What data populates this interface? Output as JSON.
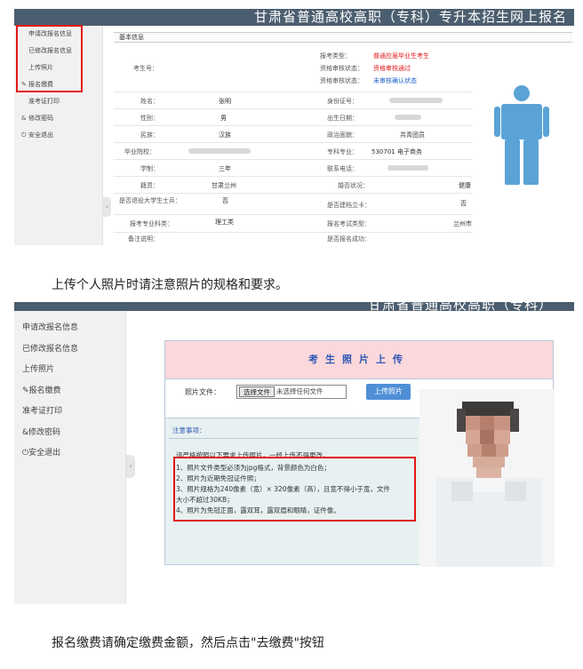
{
  "panel1": {
    "header_title": "甘肃省普通高校高职（专科）专升本招生网上报名",
    "sidebar": [
      {
        "glyph": "",
        "label": "申请改报名信息"
      },
      {
        "glyph": "",
        "label": "已修改报名信息"
      },
      {
        "glyph": "",
        "label": "上传照片"
      },
      {
        "glyph": "✎",
        "label": "报名缴费"
      },
      {
        "glyph": "",
        "label": "准考证打印"
      },
      {
        "glyph": "&",
        "label": "修改密码"
      },
      {
        "glyph": "⏻",
        "label": "安全退出"
      }
    ],
    "collapse_glyph": "‹",
    "table_title": "基本信息",
    "top_labels": {
      "kaoshenghao": "考生号：",
      "shenheqingkuang": "报考类型：",
      "zigeshenhe": "资格审核状态：",
      "quanxian": "资格审核状态："
    },
    "top_values": {
      "leixing": "普通应届毕业生考生",
      "zige": "资格审核通过",
      "shenhe": "未审核确认状态"
    },
    "rows": [
      {
        "l1": "姓名：",
        "v1": "张明",
        "l2": "身份证号：",
        "v2": ""
      },
      {
        "l1": "性别：",
        "v1": "男",
        "l2": "出生日期：",
        "v2": ""
      },
      {
        "l1": "民族：",
        "v1": "汉族",
        "l2": "政治面貌：",
        "v2": "共青团员"
      },
      {
        "l1": "毕业院校：",
        "v1": "",
        "l2": "专科专业：",
        "v2": "530701 电子商务"
      },
      {
        "l1": "学制：",
        "v1": "三年",
        "l2": "联系电话：",
        "v2": ""
      },
      {
        "l1": "籍贯：",
        "v1": "甘肃兰州",
        "l2": "婚否状况：",
        "v2": "健康"
      },
      {
        "l1": "是否退役大学生士兵：",
        "v1": "否",
        "l2": "是否建档立卡：",
        "v2": "否"
      },
      {
        "l1": "报考专业科类：",
        "v1": "理工类",
        "l2": "报名考试类型：",
        "v2": "兰州市"
      },
      {
        "l1": "备注说明：",
        "v1": "",
        "l2": "是否报名成功：",
        "v2": ""
      }
    ]
  },
  "caption1": "上传个人照片时请注意照片的规格和要求。",
  "panel2": {
    "header_title": "甘肃省普通高校高职（专科）",
    "sidebar": [
      "申请改报名信息",
      "已修改报名信息",
      "上传照片",
      "✎报名缴费",
      "准考证打印",
      "&修改密码",
      "⏻安全退出"
    ],
    "collapse_glyph": "‹",
    "upload_title": "考生照片上传",
    "file_label": "照片文件：",
    "choose_button": "选择文件",
    "no_file": "未选择任何文件",
    "upload_button": "上传照片",
    "notes_head": "注意事项：",
    "notes_intro": "请严格按照以下要求上传照片，一经上传不得更改。",
    "notes": [
      "1、照片文件类型必须为jpg格式，背景颜色为白色；",
      "2、照片为近期免冠证件照；",
      "3、照片规格为240像素（宽）× 320像素（高），且宽不得小于宽，文件",
      "大小不超过30KB；",
      "4、照片为免冠正面，露双耳，露双眉和眼睛，证件像。"
    ]
  },
  "caption2": "报名缴费请确定缴费金额，然后点击\"去缴费\"按钮",
  "colors": {
    "header": "#4b5e6f",
    "highlight": "#e01818",
    "accent": "#2c57b4",
    "button": "#4f8fd6",
    "silhouette": "#5aa3d6"
  }
}
